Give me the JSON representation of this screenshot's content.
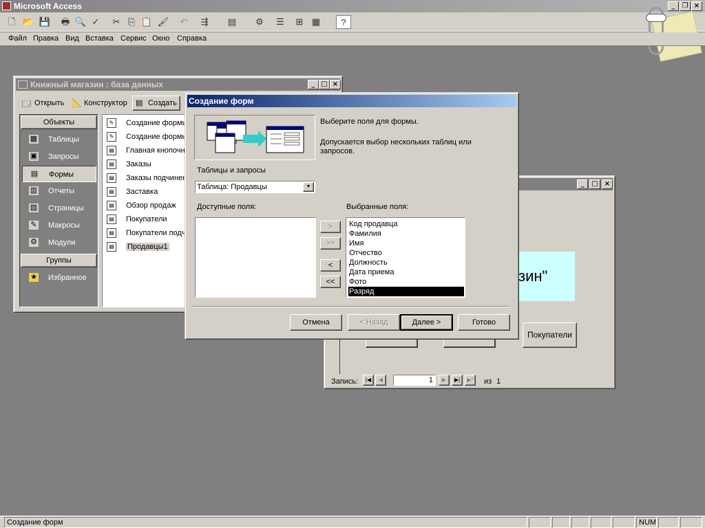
{
  "app": {
    "title": "Microsoft Access",
    "restore_icon": "restore-glyph"
  },
  "menu": [
    "Файл",
    "Правка",
    "Вид",
    "Вставка",
    "Сервис",
    "Окно",
    "Справка"
  ],
  "db_window": {
    "title": "Книжный магазин : база данных",
    "toolbar": {
      "open": "Открыть",
      "design": "Конструктор",
      "create": "Создать"
    },
    "objects_header": "Объекты",
    "objects": [
      "Таблицы",
      "Запросы",
      "Формы",
      "Отчеты",
      "Страницы",
      "Макросы",
      "Модули"
    ],
    "groups_header": "Группы",
    "favorites": "Избранное",
    "items": [
      "Создание формы",
      "Создание формы",
      "Главная кнопочн",
      "Заказы",
      "Заказы подчинен",
      "Заставка",
      "Обзор продаж",
      "Покупатели",
      "Покупатели подч",
      "Продавцы1"
    ]
  },
  "form_window": {
    "banner_text": "зин\"",
    "button_label": "Покупатели",
    "nav": {
      "label": "Запись:",
      "current": "1",
      "of": "из",
      "total": "1"
    }
  },
  "wizard": {
    "title": "Создание форм",
    "prompt": "Выберите поля для формы.",
    "hint": "Допускается выбор нескольких таблиц или запросов.",
    "tables_label": "Таблицы и запросы",
    "tables_value": "Таблица: Продавцы",
    "available_label": "Доступные поля:",
    "selected_label": "Выбранные поля:",
    "selected_fields": [
      "Код продавца",
      "Фамилия",
      "Имя",
      "Отчество",
      "Должность",
      "Дата приема",
      "Фото",
      "Разряд"
    ],
    "highlighted_field": "Разряд",
    "move_buttons": [
      ">",
      ">>",
      "<",
      "<<"
    ],
    "buttons": {
      "cancel": "Отмена",
      "back": "< Назад",
      "next": "Далее >",
      "finish": "Готово"
    }
  },
  "status": {
    "text": "Создание форм",
    "num": "NUM"
  }
}
